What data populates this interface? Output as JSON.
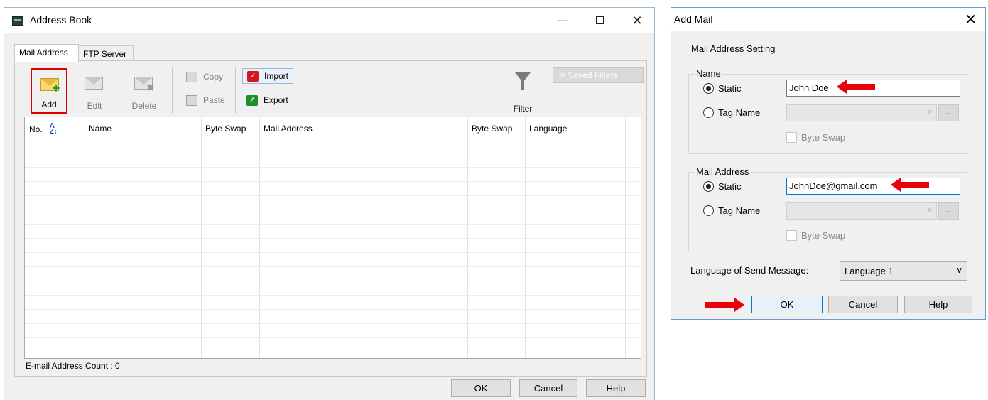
{
  "address_book": {
    "title": "Address Book",
    "tabs": [
      "Mail Address",
      "FTP Server"
    ],
    "toolbar": {
      "add": "Add",
      "edit": "Edit",
      "delete": "Delete",
      "copy": "Copy",
      "paste": "Paste",
      "import": "Import",
      "export": "Export",
      "filter": "Filter",
      "saved_filters": "Saved Filters"
    },
    "columns": [
      "No.",
      "Name",
      "Byte Swap",
      "Mail Address",
      "Byte Swap",
      "Language"
    ],
    "count_label": "E-mail Address Count : 0",
    "buttons": {
      "ok": "OK",
      "cancel": "Cancel",
      "help": "Help"
    }
  },
  "add_mail": {
    "title": "Add Mail",
    "group_title": "Mail Address Setting",
    "name_group": {
      "legend": "Name",
      "static_label": "Static",
      "static_value": "John Doe",
      "tag_label": "Tag Name",
      "byte_swap": "Byte Swap"
    },
    "mail_group": {
      "legend": "Mail Address",
      "static_label": "Static",
      "static_value": "JohnDoe@gmail.com",
      "tag_label": "Tag Name",
      "byte_swap": "Byte Swap"
    },
    "language_label": "Language of Send Message:",
    "language_value": "Language 1",
    "buttons": {
      "ok": "OK",
      "cancel": "Cancel",
      "help": "Help"
    }
  },
  "colors": {
    "highlight_red": "#e8000b",
    "focus_blue": "#0078d7"
  }
}
